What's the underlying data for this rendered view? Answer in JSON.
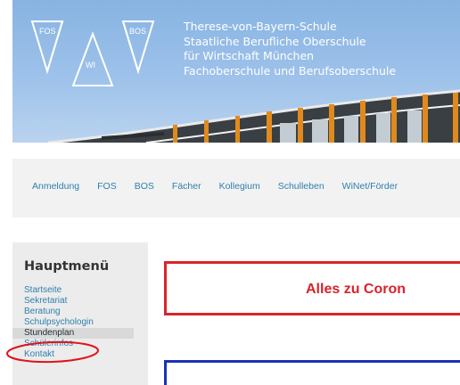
{
  "header": {
    "logo": {
      "labels": [
        "FOS",
        "WI",
        "BOS"
      ]
    },
    "school_lines": [
      "Therese-von-Bayern-Schule",
      "Staatliche Berufliche Oberschule",
      "für Wirtschaft München",
      "Fachoberschule und Berufsoberschule"
    ]
  },
  "topnav": {
    "items": [
      "Anmeldung",
      "FOS",
      "BOS",
      "Fächer",
      "Kollegium",
      "Schulleben",
      "WiNet/Förder"
    ]
  },
  "sidebar": {
    "title": "Hauptmenü",
    "items": [
      {
        "label": "Startseite"
      },
      {
        "label": "Sekretariat"
      },
      {
        "label": "Beratung"
      },
      {
        "label": "Schulpsychologin"
      },
      {
        "label": "Stundenplan",
        "active": true,
        "annotated": true
      },
      {
        "label": "Schülerinfos"
      },
      {
        "label": "Kontakt"
      }
    ]
  },
  "content": {
    "corona_banner": "Alles zu Coron"
  },
  "colors": {
    "link": "#2f7fae",
    "corona_red": "#d9232b",
    "annotation_red": "#e0131b",
    "blue_box": "#1a31b8",
    "banner_sky": "#9ec2ea"
  }
}
